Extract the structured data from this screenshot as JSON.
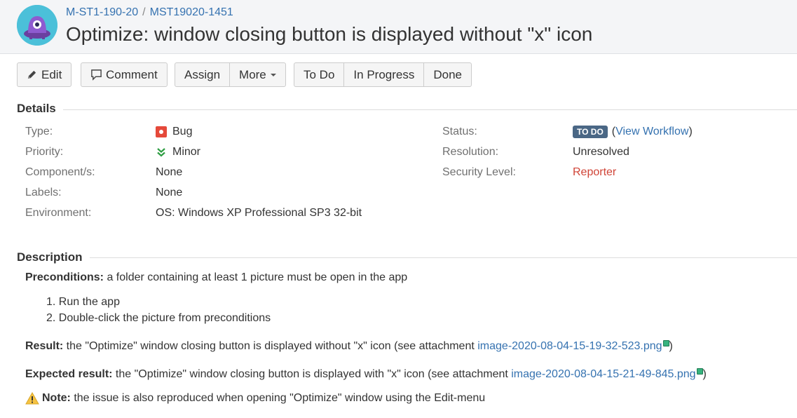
{
  "header": {
    "breadcrumb_project": "M-ST1-190-20",
    "breadcrumb_separator": "/",
    "breadcrumb_issue": "MST19020-1451",
    "title": "Optimize: window closing button is displayed without \"x\" icon"
  },
  "toolbar": {
    "edit": "Edit",
    "comment": "Comment",
    "assign": "Assign",
    "more": "More",
    "todo": "To Do",
    "in_progress": "In Progress",
    "done": "Done"
  },
  "details": {
    "heading": "Details",
    "type_label": "Type:",
    "type_value": "Bug",
    "priority_label": "Priority:",
    "priority_value": "Minor",
    "components_label": "Component/s:",
    "components_value": "None",
    "labels_label": "Labels:",
    "labels_value": "None",
    "environment_label": "Environment:",
    "environment_value": "OS: Windows XP Professional SP3 32-bit",
    "status_label": "Status:",
    "status_value": "TO DO",
    "view_workflow_open": "(",
    "view_workflow": "View Workflow",
    "view_workflow_close": ")",
    "resolution_label": "Resolution:",
    "resolution_value": "Unresolved",
    "security_label": "Security Level:",
    "security_value": "Reporter"
  },
  "description": {
    "heading": "Description",
    "preconditions_label": "Preconditions:",
    "preconditions_text": " a folder containing at least 1 picture must be open in the app",
    "steps": [
      "Run the app",
      "Double-click the picture from preconditions"
    ],
    "result_label": "Result:",
    "result_text": " the \"Optimize\" window closing button is displayed without \"x\" icon (see attachment ",
    "result_link": "image-2020-08-04-15-19-32-523.png",
    "result_close": ")",
    "expected_label": "Expected result:",
    "expected_text": " the \"Optimize\" window closing button is displayed with \"x\" icon (see attachment ",
    "expected_link": "image-2020-08-04-15-21-49-845.png",
    "expected_close": ")",
    "note_label": "Note:",
    "note_text": " the issue is also reproduced when opening \"Optimize\" window using the Edit-menu"
  },
  "colors": {
    "link": "#3572b0",
    "status_lozenge": "#4a6785",
    "bug": "#e5493a",
    "priority_minor": "#2f9e44",
    "security": "#d04437"
  }
}
